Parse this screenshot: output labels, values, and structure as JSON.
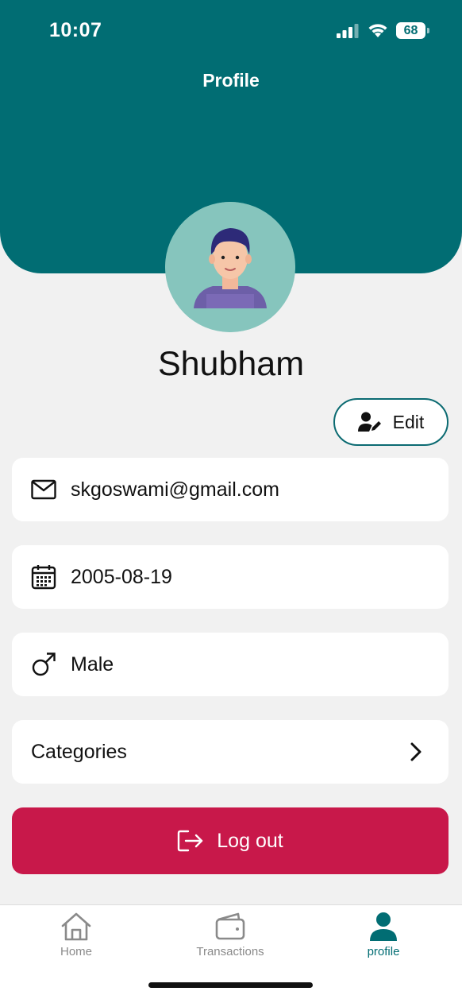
{
  "status_bar": {
    "time": "10:07",
    "battery_level": "68"
  },
  "header": {
    "title": "Profile"
  },
  "profile": {
    "name": "Shubham",
    "edit_label": "Edit",
    "email": "skgoswami@gmail.com",
    "birthdate": "2005-08-19",
    "gender": "Male",
    "categories_label": "Categories",
    "logout_label": "Log out"
  },
  "tabbar": {
    "items": [
      {
        "label": "Home",
        "icon": "home-icon",
        "active": false
      },
      {
        "label": "Transactions",
        "icon": "wallet-icon",
        "active": false
      },
      {
        "label": "profile",
        "icon": "person-icon",
        "active": true
      }
    ]
  },
  "colors": {
    "header": "#016d73",
    "accent": "#016d73",
    "logout": "#c8184a",
    "background": "#f1f1f1"
  }
}
